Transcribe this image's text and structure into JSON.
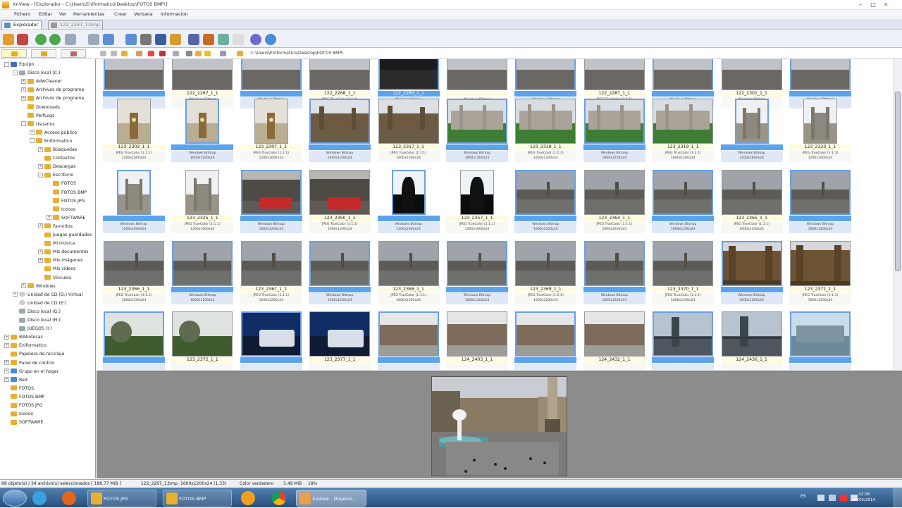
{
  "window": {
    "title": "XnView - [Explorador - C:\\Users\\Eniformatico\\Desktop\\FOTOS BMP\\]"
  },
  "menu": [
    "Fichero",
    "Editar",
    "Ver",
    "Herramientas",
    "Crear",
    "Ventana",
    "Informacion"
  ],
  "tabs": [
    {
      "label": "Explorador"
    },
    {
      "label": "122_2267_1.bmp"
    }
  ],
  "path": "C:\\Users\\Eniformatico\\Desktop\\FOTOS BMP\\",
  "tree": [
    {
      "label": "Equipo",
      "indent": 0,
      "icon": "pc",
      "exp": "-"
    },
    {
      "label": "Disco local (C:)",
      "indent": 1,
      "icon": "drive",
      "exp": "-"
    },
    {
      "label": "AdwCleaner",
      "indent": 2,
      "icon": "folder",
      "exp": "+"
    },
    {
      "label": "Archivos de programa",
      "indent": 2,
      "icon": "folder",
      "exp": "+"
    },
    {
      "label": "Archivos de programa",
      "indent": 2,
      "icon": "folder",
      "exp": "+"
    },
    {
      "label": "Downloads",
      "indent": 2,
      "icon": "folder",
      "exp": ""
    },
    {
      "label": "PerfLogs",
      "indent": 2,
      "icon": "folder",
      "exp": ""
    },
    {
      "label": "Usuarios",
      "indent": 2,
      "icon": "folder",
      "exp": "-"
    },
    {
      "label": "Acceso público",
      "indent": 3,
      "icon": "folder",
      "exp": "+"
    },
    {
      "label": "Eniformatico",
      "indent": 3,
      "icon": "folder",
      "exp": "-"
    },
    {
      "label": "Búsquedas",
      "indent": 4,
      "icon": "folder",
      "exp": "+"
    },
    {
      "label": "Contactos",
      "indent": 4,
      "icon": "folder",
      "exp": ""
    },
    {
      "label": "Descargas",
      "indent": 4,
      "icon": "folder",
      "exp": "+"
    },
    {
      "label": "Escritorio",
      "indent": 4,
      "icon": "folder",
      "exp": "-"
    },
    {
      "label": "FOTOS",
      "indent": 5,
      "icon": "folder",
      "exp": ""
    },
    {
      "label": "FOTOS BMP",
      "indent": 5,
      "icon": "folder",
      "exp": ""
    },
    {
      "label": "FOTOS JPG",
      "indent": 5,
      "icon": "folder",
      "exp": ""
    },
    {
      "label": "Iconos",
      "indent": 5,
      "icon": "folder",
      "exp": ""
    },
    {
      "label": "SOFTWARE",
      "indent": 5,
      "icon": "folder",
      "exp": "+"
    },
    {
      "label": "Favoritos",
      "indent": 4,
      "icon": "folder",
      "exp": "+"
    },
    {
      "label": "Juegos guardados",
      "indent": 4,
      "icon": "folder",
      "exp": ""
    },
    {
      "label": "Mi música",
      "indent": 4,
      "icon": "folder",
      "exp": ""
    },
    {
      "label": "Mis documentos",
      "indent": 4,
      "icon": "folder",
      "exp": "+"
    },
    {
      "label": "Mis imágenes",
      "indent": 4,
      "icon": "folder",
      "exp": "+"
    },
    {
      "label": "Mis vídeos",
      "indent": 4,
      "icon": "folder",
      "exp": ""
    },
    {
      "label": "Vínculos",
      "indent": 4,
      "icon": "folder",
      "exp": ""
    },
    {
      "label": "Windows",
      "indent": 2,
      "icon": "folder",
      "exp": "+"
    },
    {
      "label": "Unidad de CD (D:) Virtual",
      "indent": 1,
      "icon": "cd",
      "exp": "+"
    },
    {
      "label": "Unidad de CD (E:)",
      "indent": 1,
      "icon": "cd",
      "exp": ""
    },
    {
      "label": "Disco local (G:)",
      "indent": 1,
      "icon": "drive",
      "exp": ""
    },
    {
      "label": "Disco local (H:)",
      "indent": 1,
      "icon": "drive",
      "exp": ""
    },
    {
      "label": "JUEGOS (I:)",
      "indent": 1,
      "icon": "drive",
      "exp": ""
    },
    {
      "label": "Bibliotecas",
      "indent": 0,
      "icon": "folder",
      "exp": "+"
    },
    {
      "label": "Eniformatico",
      "indent": 0,
      "icon": "folder",
      "exp": "+"
    },
    {
      "label": "Papelera de reciclaje",
      "indent": 0,
      "icon": "folder",
      "exp": ""
    },
    {
      "label": "Panel de control",
      "indent": 0,
      "icon": "folder",
      "exp": "+"
    },
    {
      "label": "Grupo en el hogar",
      "indent": 0,
      "icon": "net",
      "exp": "+"
    },
    {
      "label": "Red",
      "indent": 0,
      "icon": "net",
      "exp": "+"
    },
    {
      "label": "FOTOS",
      "indent": 0,
      "icon": "folder",
      "exp": ""
    },
    {
      "label": "FOTOS BMP",
      "indent": 0,
      "icon": "folder",
      "exp": ""
    },
    {
      "label": "FOTOS JPG",
      "indent": 0,
      "icon": "folder",
      "exp": ""
    },
    {
      "label": "Iconos",
      "indent": 0,
      "icon": "folder",
      "exp": ""
    },
    {
      "label": "SOFTWARE",
      "indent": 0,
      "icon": "folder",
      "exp": ""
    }
  ],
  "thumbnails": [
    [
      {
        "name": "",
        "sel": true,
        "meta": [
          "",
          ""
        ],
        "scene": "top"
      },
      {
        "name": "122_2267_1_1",
        "sel": false,
        "meta": [
          "Windows Bitmap",
          "1600x1200x24"
        ],
        "scene": "top"
      },
      {
        "name": "",
        "sel": true,
        "meta": [
          "Windows Bitmap",
          "1600x1200x24"
        ],
        "scene": "top"
      },
      {
        "name": "122_2268_1_1",
        "sel": false,
        "meta": [
          "JPEG TrueColor (1:1:1)",
          "1600x1200x24"
        ],
        "scene": "top"
      },
      {
        "name": "122_2285_1_1",
        "sel": true,
        "meta": [
          "Windows Bitmap",
          "1600x1200x24"
        ],
        "scene": "topdark"
      },
      {
        "name": "",
        "sel": false,
        "meta": [
          "Windows Bitmap",
          "1600x1200x24"
        ],
        "scene": "top"
      },
      {
        "name": "",
        "sel": true,
        "meta": [
          "Windows Bitmap",
          "1600x1200x24"
        ],
        "scene": "top"
      },
      {
        "name": "122_2287_1_1",
        "sel": false,
        "meta": [
          "JPEG TrueColor (1:1:1)",
          "1600x1200x24"
        ],
        "scene": "top"
      },
      {
        "name": "",
        "sel": true,
        "meta": [
          "Windows Bitmap",
          "1600x1200x24"
        ],
        "scene": "top"
      },
      {
        "name": "122_2301_1_1",
        "sel": false,
        "meta": [
          "Windows Bitmap",
          "1600x1200x24"
        ],
        "scene": "top"
      },
      {
        "name": "",
        "sel": true,
        "meta": [
          "Windows Bitmap",
          "1200x1600x24"
        ],
        "scene": "top"
      }
    ],
    [
      {
        "name": "123_2302_1_1",
        "sel": false,
        "meta": [
          "JPEG TrueColor (1:1:1)",
          "1200x1600x24"
        ],
        "scene": "bigben"
      },
      {
        "name": "",
        "sel": true,
        "meta": [
          "Windows Bitmap",
          "1600x1200x24"
        ],
        "scene": "bigben"
      },
      {
        "name": "123_2307_1_1",
        "sel": false,
        "meta": [
          "JPEG TrueColor (1:1:1)",
          "1200x1600x24"
        ],
        "scene": "bigben"
      },
      {
        "name": "",
        "sel": true,
        "meta": [
          "Windows Bitmap",
          "1600x1200x24"
        ],
        "scene": "parliament"
      },
      {
        "name": "123_2317_1_1",
        "sel": false,
        "meta": [
          "JPEG TrueColor (1:1:1)",
          "1600x1200x24"
        ],
        "scene": "parliament"
      },
      {
        "name": "",
        "sel": true,
        "meta": [
          "Windows Bitmap",
          "1600x1200x24"
        ],
        "scene": "abbey"
      },
      {
        "name": "123_2318_1_1",
        "sel": false,
        "meta": [
          "JPEG TrueColor (1:1:1)",
          "1600x1200x24"
        ],
        "scene": "abbey"
      },
      {
        "name": "",
        "sel": true,
        "meta": [
          "Windows Bitmap",
          "1600x1200x24"
        ],
        "scene": "abbey"
      },
      {
        "name": "123_2319_1_1",
        "sel": false,
        "meta": [
          "JPEG TrueColor (1:1:1)",
          "1600x1200x24"
        ],
        "scene": "abbey"
      },
      {
        "name": "",
        "sel": true,
        "meta": [
          "Windows Bitmap",
          "1200x1600x24"
        ],
        "scene": "abbeyfront"
      },
      {
        "name": "123_2320_1_1",
        "sel": false,
        "meta": [
          "JPEG TrueColor (1:1:1)",
          "1200x1600x24"
        ],
        "scene": "abbeyfront"
      }
    ],
    [
      {
        "name": "",
        "sel": true,
        "meta": [
          "Windows Bitmap",
          "1200x1600x24"
        ],
        "scene": "abbeyfront"
      },
      {
        "name": "123_2325_1_1",
        "sel": false,
        "meta": [
          "JPEG TrueColor (1:1:1)",
          "1200x1600x24"
        ],
        "scene": "abbeyfront"
      },
      {
        "name": "",
        "sel": true,
        "meta": [
          "Windows Bitmap",
          "1600x1200x24"
        ],
        "scene": "bus"
      },
      {
        "name": "123_2350_1_1",
        "sel": false,
        "meta": [
          "JPEG TrueColor (1:1:1)",
          "1600x1200x24"
        ],
        "scene": "bus"
      },
      {
        "name": "",
        "sel": true,
        "meta": [
          "Windows Bitmap",
          "1200x1600x24"
        ],
        "scene": "silhouette"
      },
      {
        "name": "123_2357_1_1",
        "sel": false,
        "meta": [
          "JPEG TrueColor (1:1:1)",
          "1200x1600x24"
        ],
        "scene": "silhouette"
      },
      {
        "name": "",
        "sel": true,
        "meta": [
          "Windows Bitmap",
          "1600x1200x24"
        ],
        "scene": "river"
      },
      {
        "name": "123_2364_1_1",
        "sel": false,
        "meta": [
          "JPEG TrueColor (1:1:1)",
          "1600x1200x24"
        ],
        "scene": "river"
      },
      {
        "name": "",
        "sel": true,
        "meta": [
          "Windows Bitmap",
          "1600x1200x24"
        ],
        "scene": "river"
      },
      {
        "name": "123_2365_1_1",
        "sel": false,
        "meta": [
          "JPEG TrueColor (1:1:1)",
          "1600x1200x24"
        ],
        "scene": "river"
      },
      {
        "name": "",
        "sel": true,
        "meta": [
          "Windows Bitmap",
          "1600x1200x24"
        ],
        "scene": "river"
      }
    ],
    [
      {
        "name": "123_2366_1_1",
        "sel": false,
        "meta": [
          "JPEG TrueColor (1:1:1)",
          "1600x1200x24"
        ],
        "scene": "river"
      },
      {
        "name": "",
        "sel": true,
        "meta": [
          "Windows Bitmap",
          "1600x1200x24"
        ],
        "scene": "river"
      },
      {
        "name": "123_2367_1_1",
        "sel": false,
        "meta": [
          "JPEG TrueColor (1:1:1)",
          "1600x1200x24"
        ],
        "scene": "river"
      },
      {
        "name": "",
        "sel": true,
        "meta": [
          "Windows Bitmap",
          "1600x1200x24"
        ],
        "scene": "river"
      },
      {
        "name": "123_2368_1_1",
        "sel": false,
        "meta": [
          "JPEG TrueColor (1:1:1)",
          "1600x1200x24"
        ],
        "scene": "river"
      },
      {
        "name": "",
        "sel": true,
        "meta": [
          "Windows Bitmap",
          "1600x1200x24"
        ],
        "scene": "river"
      },
      {
        "name": "123_2369_1_1",
        "sel": false,
        "meta": [
          "JPEG TrueColor (1:1:1)",
          "1600x1200x24"
        ],
        "scene": "river"
      },
      {
        "name": "",
        "sel": true,
        "meta": [
          "Windows Bitmap",
          "1600x1200x24"
        ],
        "scene": "river"
      },
      {
        "name": "123_2370_1_1",
        "sel": false,
        "meta": [
          "JPEG TrueColor (1:1:1)",
          "1600x1200x24"
        ],
        "scene": "river"
      },
      {
        "name": "",
        "sel": true,
        "meta": [
          "Windows Bitmap",
          "1600x1200x24"
        ],
        "scene": "gothic"
      },
      {
        "name": "123_2371_1_1",
        "sel": false,
        "meta": [
          "JPEG TrueColor (1:1:1)",
          "1600x1200x24"
        ],
        "scene": "gothic"
      }
    ],
    [
      {
        "name": "",
        "sel": true,
        "meta": [
          "",
          ""
        ],
        "scene": "park"
      },
      {
        "name": "123_2372_1_1",
        "sel": false,
        "meta": [
          "",
          ""
        ],
        "scene": "park"
      },
      {
        "name": "",
        "sel": true,
        "meta": [
          "",
          ""
        ],
        "scene": "nightbus"
      },
      {
        "name": "123_2377_1_1",
        "sel": false,
        "meta": [
          "",
          ""
        ],
        "scene": "nightbus"
      },
      {
        "name": "",
        "sel": true,
        "meta": [
          "",
          ""
        ],
        "scene": "street"
      },
      {
        "name": "124_2403_1_1",
        "sel": false,
        "meta": [
          "",
          ""
        ],
        "scene": "street"
      },
      {
        "name": "",
        "sel": true,
        "meta": [
          "",
          ""
        ],
        "scene": "street"
      },
      {
        "name": "124_2432_1_1",
        "sel": false,
        "meta": [
          "",
          ""
        ],
        "scene": "street"
      },
      {
        "name": "",
        "sel": true,
        "meta": [
          "",
          ""
        ],
        "scene": "bridge"
      },
      {
        "name": "124_2436_1_1",
        "sel": false,
        "meta": [
          "",
          ""
        ],
        "scene": "bridge"
      },
      {
        "name": "",
        "sel": true,
        "meta": [
          "",
          ""
        ],
        "scene": "dome"
      }
    ]
  ],
  "status": {
    "count": "68 objeto(s) / 34 archivo(s) seleccionados [ 186.77 MiB ]",
    "file": "122_2267_1.bmp",
    "dims": "1600x1200x24 (1.33)",
    "color": "Color verdadero",
    "size": "5.49 MiB",
    "zoom": "18%"
  },
  "taskbar": {
    "items": [
      {
        "label": "FOTOS JPG"
      },
      {
        "label": "FOTOS BMP"
      },
      {
        "label": ""
      },
      {
        "label": ""
      },
      {
        "label": "XnView - [Explora..."
      }
    ],
    "lang": "ES",
    "time": "12:28",
    "date": "06/05/2014"
  },
  "colors": {
    "selection": "#5ca3ee",
    "panel": "#8c8c8c"
  }
}
